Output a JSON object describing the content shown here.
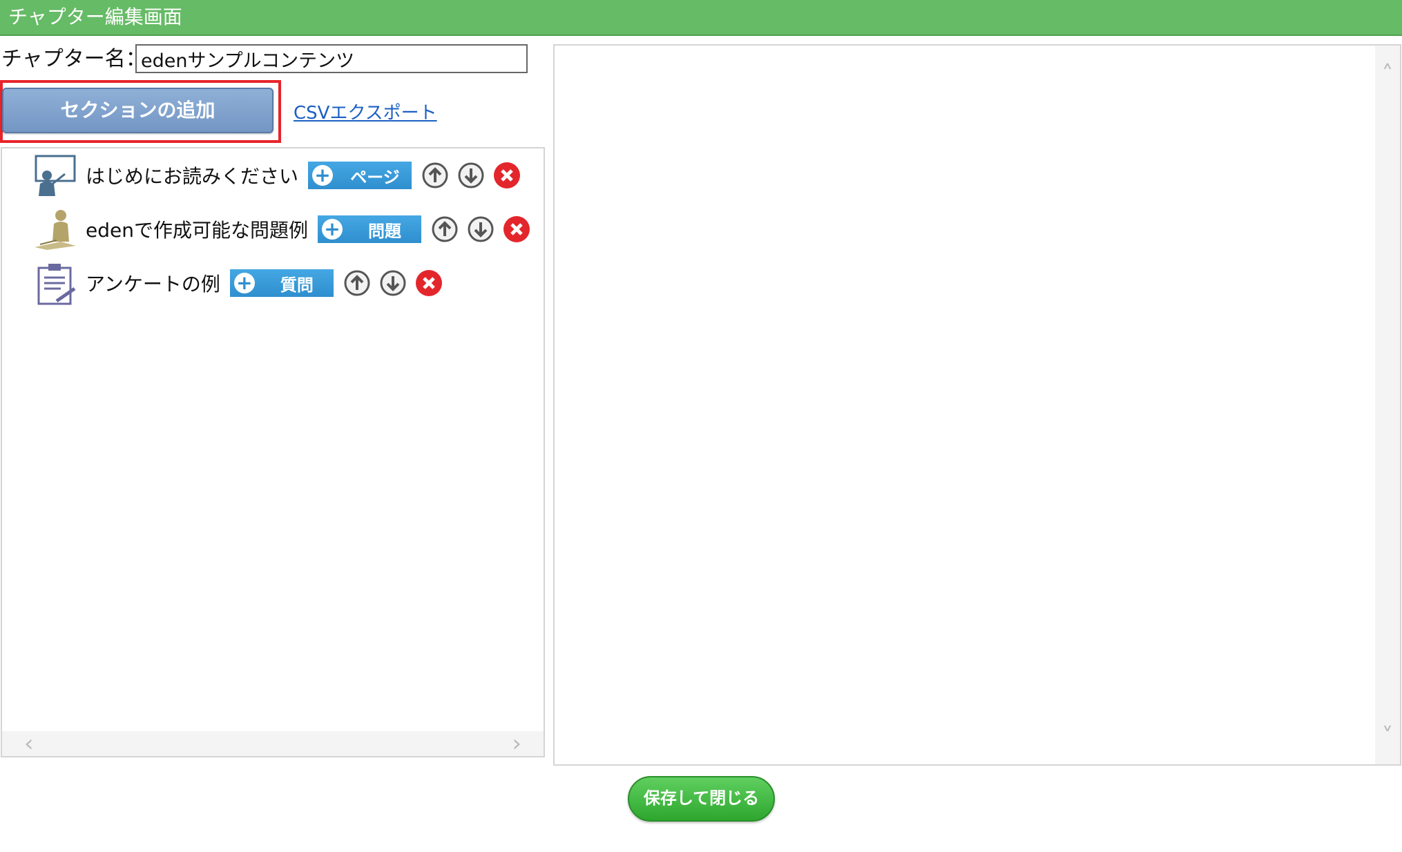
{
  "window": {
    "title": "チャプター編集画面"
  },
  "chapter": {
    "name_label": "チャプター名：",
    "name_value": "edenサンプルコンテンツ"
  },
  "toolbar": {
    "add_section_label": "セクションの追加",
    "csv_export_label": "CSVエクスポート"
  },
  "sections": [
    {
      "label": "はじめにお読みください",
      "icon": "lecture-icon",
      "add_label": "ページ"
    },
    {
      "label": "edenで作成可能な問題例",
      "icon": "exam-icon",
      "add_label": "問題"
    },
    {
      "label": "アンケートの例",
      "icon": "clipboard-icon",
      "add_label": "質問"
    }
  ],
  "footer": {
    "save_close_label": "保存して閉じる"
  },
  "colors": {
    "title_bar": "#66bb66",
    "highlight": "#e8232a",
    "add_button": "#2f8fcf",
    "save_button": "#2ea72e"
  }
}
